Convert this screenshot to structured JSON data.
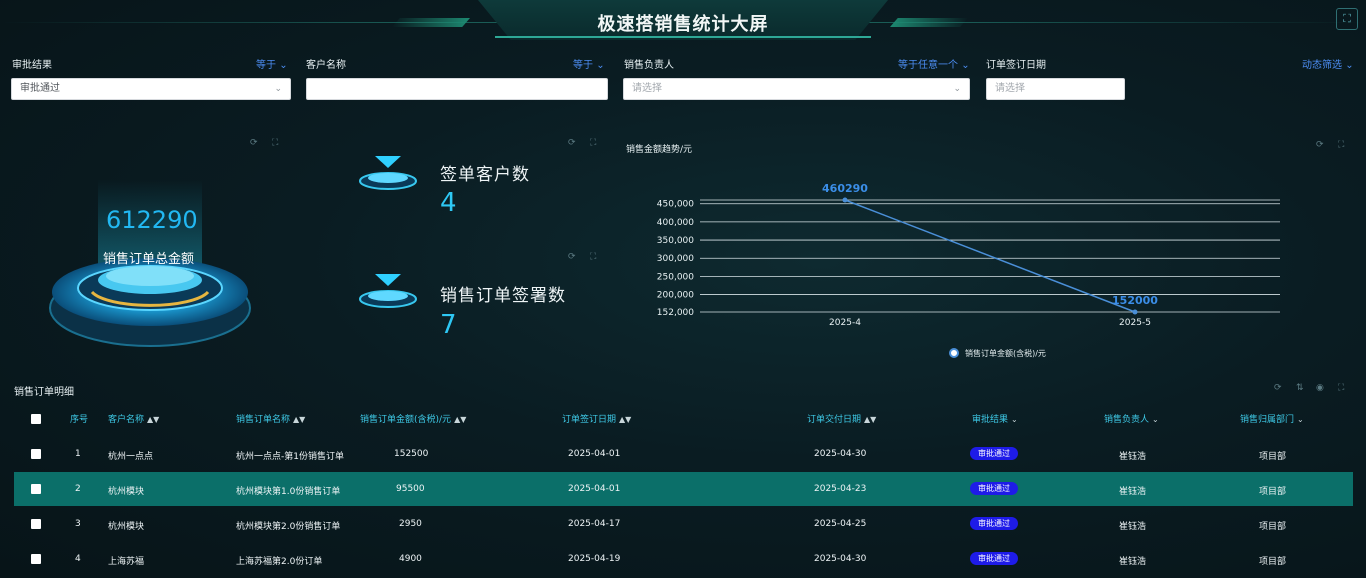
{
  "header": {
    "title": "极速搭销售统计大屏"
  },
  "filters": [
    {
      "label": "审批结果",
      "operator": "等于",
      "value": "审批通过",
      "placeholder": ""
    },
    {
      "label": "客户名称",
      "operator": "等于",
      "value": "",
      "placeholder": ""
    },
    {
      "label": "销售负责人",
      "operator": "等于任意一个",
      "value": "",
      "placeholder": "请选择"
    },
    {
      "label": "订单签订日期",
      "operator": "",
      "value": "",
      "placeholder": "请选择"
    }
  ],
  "dynamic_filter": "动态筛选",
  "total_card": {
    "value": "612290",
    "label": "销售订单总金额"
  },
  "stats": [
    {
      "label": "签单客户数",
      "value": "4"
    },
    {
      "label": "销售订单签署数",
      "value": "7"
    }
  ],
  "chart_data": {
    "type": "line",
    "title": "销售金额趋势/元",
    "categories": [
      "2025-4",
      "2025-5"
    ],
    "series": [
      {
        "name": "销售订单金额(含税)/元",
        "values": [
          460290,
          152000
        ]
      }
    ],
    "y_ticks": [
      "152,000",
      "200,000",
      "250,000",
      "300,000",
      "350,000",
      "400,000",
      "450,000"
    ],
    "ylim": [
      152000,
      460290
    ],
    "data_labels": [
      "460290",
      "152000"
    ],
    "grid": true,
    "legend": "bottom"
  },
  "table": {
    "title": "销售订单明细",
    "columns": [
      "序号",
      "客户名称",
      "销售订单名称",
      "销售订单金额(含税)/元",
      "订单签订日期",
      "订单交付日期",
      "审批结果",
      "销售负责人",
      "销售归属部门"
    ],
    "rows": [
      {
        "no": "1",
        "customer": "杭州一点点",
        "order": "杭州一点点-第1份销售订单",
        "amount": "152500",
        "sign": "2025-04-01",
        "deliver": "2025-04-30",
        "status": "审批通过",
        "owner": "崔钰浩",
        "dept": "项目部"
      },
      {
        "no": "2",
        "customer": "杭州模块",
        "order": "杭州模块第1.0份销售订单",
        "amount": "95500",
        "sign": "2025-04-01",
        "deliver": "2025-04-23",
        "status": "审批通过",
        "owner": "崔钰浩",
        "dept": "项目部"
      },
      {
        "no": "3",
        "customer": "杭州模块",
        "order": "杭州模块第2.0份销售订单",
        "amount": "2950",
        "sign": "2025-04-17",
        "deliver": "2025-04-25",
        "status": "审批通过",
        "owner": "崔钰浩",
        "dept": "项目部"
      },
      {
        "no": "4",
        "customer": "上海苏福",
        "order": "上海苏福第2.0份订单",
        "amount": "4900",
        "sign": "2025-04-19",
        "deliver": "2025-04-30",
        "status": "审批通过",
        "owner": "崔钰浩",
        "dept": "项目部"
      }
    ]
  },
  "colors": {
    "accent": "#2ec8f4",
    "highlight_row": "#0b6f69",
    "badge": "#1e1be8",
    "link": "#4c8df2"
  }
}
